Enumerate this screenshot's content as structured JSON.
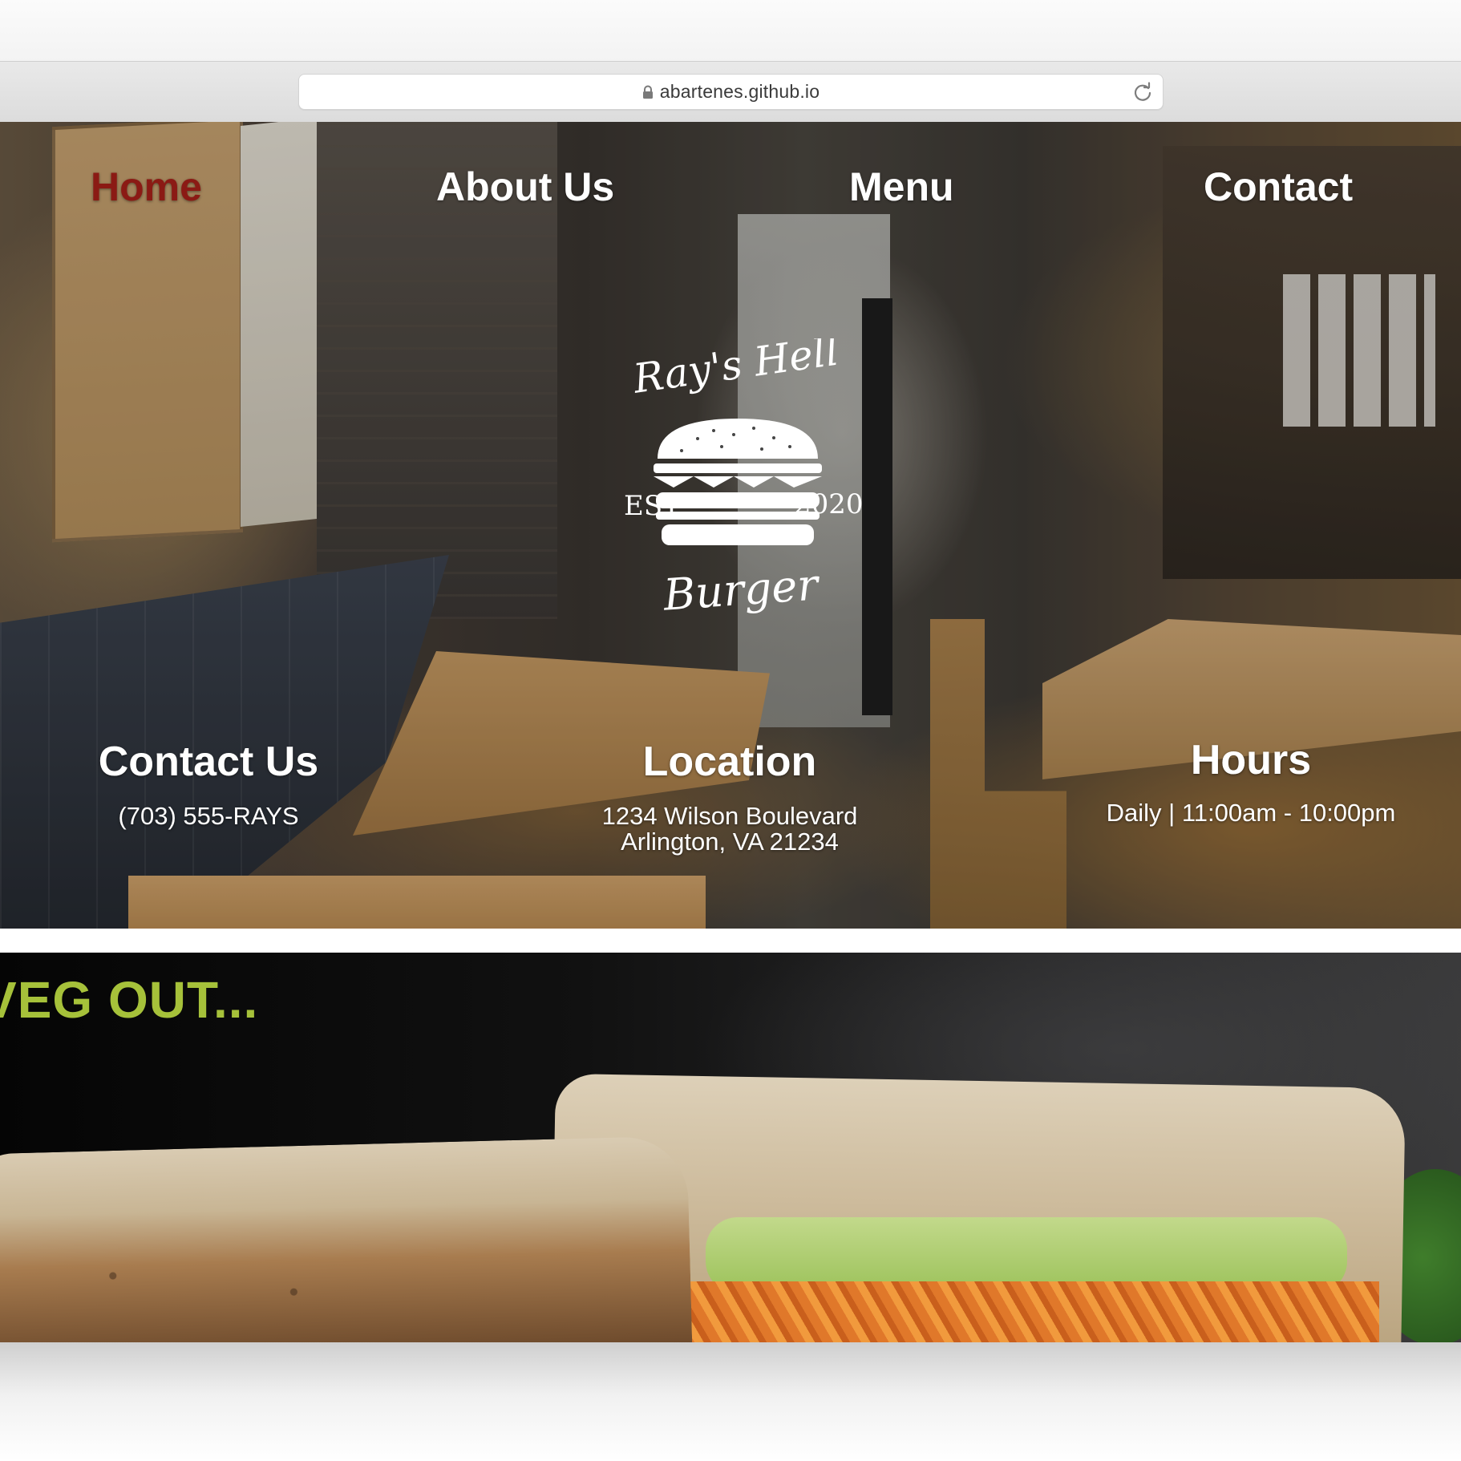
{
  "browser": {
    "url": "abartenes.github.io",
    "lock_icon": "lock-icon",
    "reload_icon": "reload-icon"
  },
  "nav": {
    "items": [
      {
        "label": "Home",
        "active": true
      },
      {
        "label": "About Us",
        "active": false
      },
      {
        "label": "Menu",
        "active": false
      },
      {
        "label": "Contact",
        "active": false
      }
    ],
    "active_color": "#8b1a14",
    "color": "#ffffff"
  },
  "logo": {
    "name_top": "Ray's Hell",
    "name_bottom": "Burger",
    "est_label": "EST.",
    "year": "2020",
    "icon": "burger-icon"
  },
  "info": {
    "contact": {
      "heading": "Contact Us",
      "phone": "(703) 555-RAYS"
    },
    "location": {
      "heading": "Location",
      "line1": "1234 Wilson Boulevard",
      "line2": "Arlington, VA 21234"
    },
    "hours": {
      "heading": "Hours",
      "text": "Daily | 11:00am - 10:00pm"
    }
  },
  "veg": {
    "title": "VEG OUT...",
    "title_color": "#a6c13a"
  }
}
